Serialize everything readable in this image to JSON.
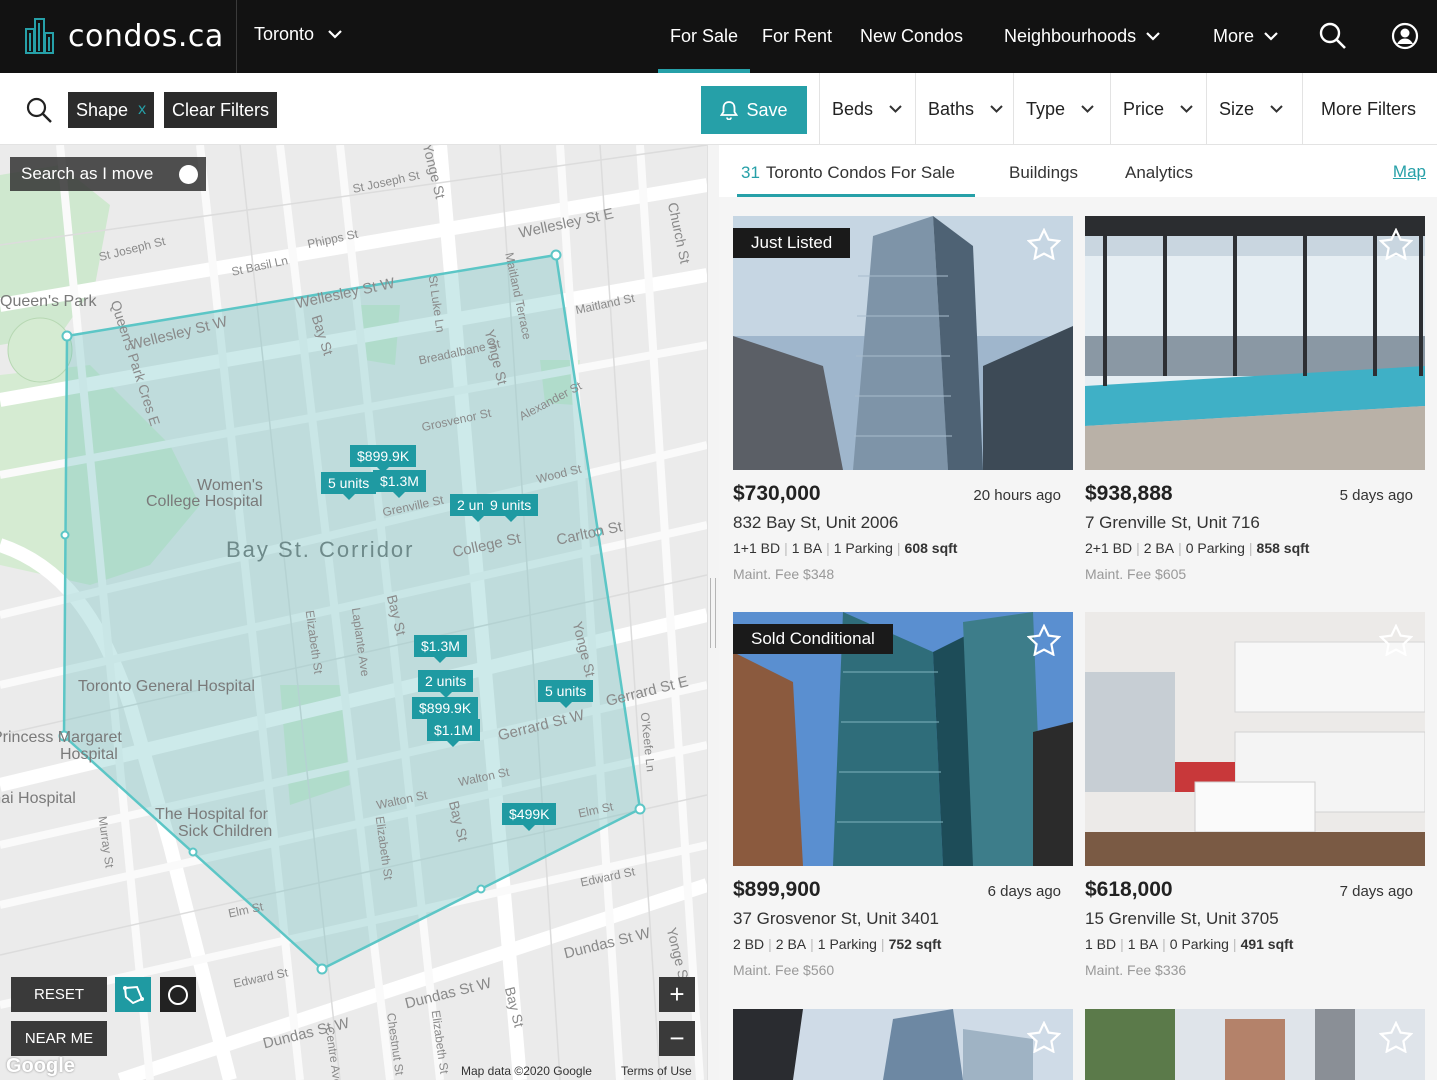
{
  "nav": {
    "logo": "condos.ca",
    "city": "Toronto",
    "links": [
      "For Sale",
      "For Rent",
      "New Condos",
      "Neighbourhoods",
      "More"
    ],
    "accent": "#26a0a8"
  },
  "filters": {
    "chips": [
      "Shape",
      "Clear Filters"
    ],
    "chip_close": "x",
    "save_label": "Save",
    "dropdowns": [
      "Beds",
      "Baths",
      "Type",
      "Price",
      "Size"
    ],
    "more_filters": "More Filters"
  },
  "map": {
    "search_as_move": "Search as I move",
    "area_label": "Bay St. Corridor",
    "places": [
      "Women's",
      "College Hospital",
      "Toronto General Hospital",
      "Princess Margaret",
      "Hospital",
      "Sinai Hospital",
      "The Hospital for",
      "Sick Children",
      "Queen's Park"
    ],
    "streets": [
      "Wellesley St E",
      "Wellesley St W",
      "Wellesley St W",
      "St Joseph St",
      "St Joseph St",
      "Phipps St",
      "St Basil Ln",
      "Maitland St",
      "Breadalbane St",
      "Grosvenor St",
      "Alexander St",
      "Wood St",
      "Grenville St",
      "College St",
      "Carlton St",
      "Gerrard St W",
      "Gerrard St E",
      "Walton St",
      "Walton St",
      "Elm St",
      "Elm St",
      "Edward St",
      "Edward St",
      "Dundas St W",
      "Dundas St W",
      "Dundas St W",
      "Queen's Park Cres E",
      "Bay St",
      "Bay St",
      "Bay St",
      "Bay St",
      "Yonge St",
      "Yonge St",
      "Yonge St",
      "Yonge St",
      "Church St",
      "St Luke Ln",
      "Maitland Terrace",
      "Elizabeth St",
      "Elizabeth St",
      "Elizabeth St",
      "Laplante Ave",
      "Murray St",
      "Chestnut St",
      "Centre Ave",
      "O'Keefe Ln"
    ],
    "markers": [
      "$899.9K",
      "5 units",
      "$1.3M",
      "2 units",
      "9 units",
      "$1.3M",
      "2 units",
      "$899.9K",
      "$1.1M",
      "5 units",
      "$499K"
    ],
    "reset": "RESET",
    "near_me": "NEAR ME",
    "zoom_in": "+",
    "zoom_out": "−",
    "attribution": "Map data ©2020 Google",
    "terms": "Terms of Use",
    "google": "Google"
  },
  "panel": {
    "count": "31",
    "title": "Toronto Condos For Sale",
    "tabs": [
      "Buildings",
      "Analytics"
    ],
    "map_link": "Map"
  },
  "listings": [
    {
      "badge": "Just Listed",
      "price": "$730,000",
      "ago": "20 hours ago",
      "address": "832 Bay St, Unit 2006",
      "beds": "1+1 BD",
      "baths": "1 BA",
      "parking": "1 Parking",
      "sqft": "608 sqft",
      "maint": "Maint. Fee $348"
    },
    {
      "badge": "",
      "price": "$938,888",
      "ago": "5 days ago",
      "address": "7 Grenville St, Unit 716",
      "beds": "2+1 BD",
      "baths": "2 BA",
      "parking": "0 Parking",
      "sqft": "858 sqft",
      "maint": "Maint. Fee $605"
    },
    {
      "badge": "Sold Conditional",
      "price": "$899,900",
      "ago": "6 days ago",
      "address": "37 Grosvenor St, Unit 3401",
      "beds": "2 BD",
      "baths": "2 BA",
      "parking": "1 Parking",
      "sqft": "752 sqft",
      "maint": "Maint. Fee $560"
    },
    {
      "badge": "",
      "price": "$618,000",
      "ago": "7 days ago",
      "address": "15 Grenville St, Unit 3705",
      "beds": "1 BD",
      "baths": "1 BA",
      "parking": "0 Parking",
      "sqft": "491 sqft",
      "maint": "Maint. Fee $336"
    },
    {
      "badge": ""
    },
    {
      "badge": ""
    }
  ]
}
